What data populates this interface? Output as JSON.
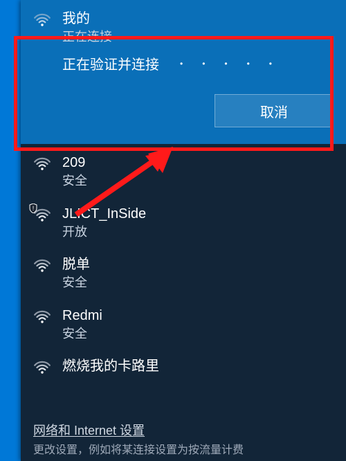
{
  "panel": {
    "connecting": {
      "name": "我的",
      "status": "正在连接",
      "verifying": "正在验证并连接",
      "cancel": "取消"
    },
    "networks": [
      {
        "name": "209",
        "status": "安全",
        "shield": false
      },
      {
        "name": "JLICT_InSide",
        "status": "开放",
        "shield": true
      },
      {
        "name": "脱单",
        "status": "安全",
        "shield": false
      },
      {
        "name": "Redmi",
        "status": "安全",
        "shield": false
      },
      {
        "name": "燃烧我的卡路里",
        "status": "",
        "shield": false
      }
    ],
    "settings_link": "网络和 Internet 设置",
    "settings_sub": "更改设置，例如将某连接设置为按流量计费"
  }
}
